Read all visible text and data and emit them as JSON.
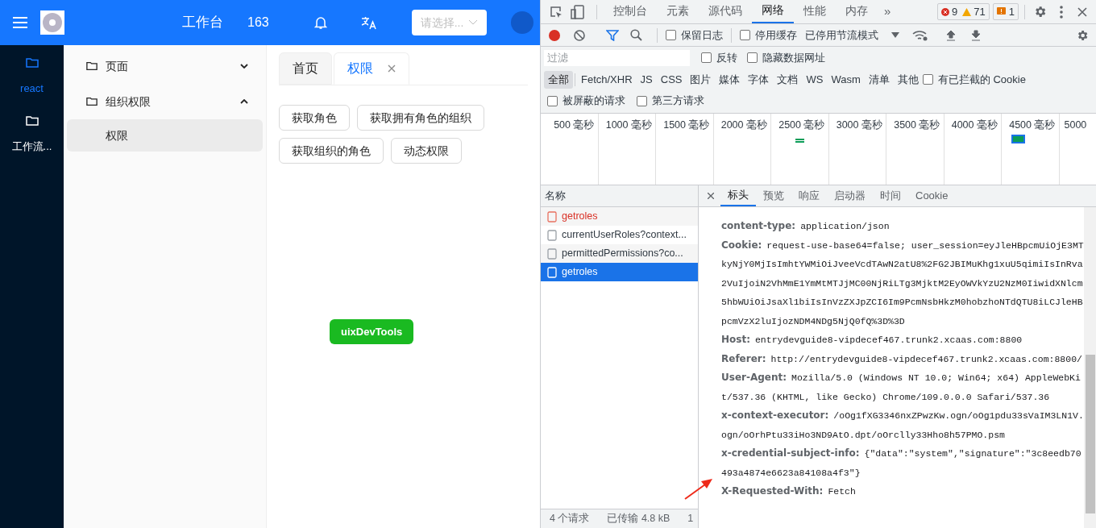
{
  "app": {
    "header": {
      "title": "工作台",
      "count": "163",
      "select_placeholder": "请选择..."
    },
    "rail": [
      {
        "label": "react",
        "selected": true
      },
      {
        "label": "工作流...",
        "selected": false
      }
    ],
    "menu": [
      {
        "label": "页面",
        "expanded": false
      },
      {
        "label": "组织权限",
        "expanded": true,
        "children": [
          {
            "label": "权限",
            "selected": true
          }
        ]
      }
    ],
    "tabs": [
      {
        "label": "首页",
        "selected": false,
        "closable": false
      },
      {
        "label": "权限",
        "selected": true,
        "closable": true
      }
    ],
    "buttons": [
      "获取角色",
      "获取拥有角色的组织",
      "获取组织的角色",
      "动态权限"
    ],
    "floating_button": "uixDevTools"
  },
  "devtools": {
    "tabs": [
      {
        "label": "控制台",
        "selected": false
      },
      {
        "label": "元素",
        "selected": false
      },
      {
        "label": "源代码",
        "selected": false
      },
      {
        "label": "网络",
        "selected": true
      },
      {
        "label": "性能",
        "selected": false
      },
      {
        "label": "内存",
        "selected": false
      }
    ],
    "more": "»",
    "errors": "9",
    "warnings": "71",
    "issues": "1",
    "toolbar": {
      "preserve_log": {
        "label": "保留日志",
        "checked": false
      },
      "disable_cache": {
        "label": "停用缓存",
        "checked": false
      },
      "throttling": "已停用节流模式"
    },
    "filter": {
      "placeholder": "过滤",
      "invert": {
        "label": "反转",
        "checked": false
      },
      "hide_data_urls": {
        "label": "隐藏数据网址",
        "checked": false
      }
    },
    "types": [
      {
        "label": "全部",
        "selected": true
      },
      {
        "label": "Fetch/XHR",
        "selected": false
      },
      {
        "label": "JS",
        "selected": false
      },
      {
        "label": "CSS",
        "selected": false
      },
      {
        "label": "图片",
        "selected": false
      },
      {
        "label": "媒体",
        "selected": false
      },
      {
        "label": "字体",
        "selected": false
      },
      {
        "label": "文档",
        "selected": false
      },
      {
        "label": "WS",
        "selected": false
      },
      {
        "label": "Wasm",
        "selected": false
      },
      {
        "label": "清单",
        "selected": false
      },
      {
        "label": "其他",
        "selected": false
      }
    ],
    "blocked_cookies": {
      "label": "有已拦截的 Cookie",
      "checked": false
    },
    "blocked_requests": {
      "label": "被屏蔽的请求",
      "checked": false
    },
    "third_party": {
      "label": "第三方请求",
      "checked": false
    },
    "timeline_ticks": [
      "500 毫秒",
      "1000 毫秒",
      "1500 毫秒",
      "2000 毫秒",
      "2500 毫秒",
      "3000 毫秒",
      "3500 毫秒",
      "4000 毫秒",
      "4500 毫秒",
      "5000"
    ],
    "name_column": "名称",
    "requests": [
      {
        "name": "getroles",
        "failed": true,
        "selected": false
      },
      {
        "name": "currentUserRoles?context...",
        "failed": false,
        "selected": false
      },
      {
        "name": "permittedPermissions?co...",
        "failed": false,
        "selected": false
      },
      {
        "name": "getroles",
        "failed": false,
        "selected": true
      }
    ],
    "detail_tabs": [
      {
        "label": "标头",
        "selected": true
      },
      {
        "label": "预览",
        "selected": false
      },
      {
        "label": "响应",
        "selected": false
      },
      {
        "label": "启动器",
        "selected": false
      },
      {
        "label": "时间",
        "selected": false
      },
      {
        "label": "Cookie",
        "selected": false
      }
    ],
    "headers": [
      {
        "name": "content-type:",
        "value": "application/json"
      },
      {
        "name": "Cookie:",
        "value": "request-use-base64=false; user_session=eyJleHBpcmUiOjE3MTkyNjY0MjIsImhtYWMiOiJveeVcdTAwN2atU8%2FG2JBIMuKhg1xuU5qimiIsInRva2VuIjoiN2VhMmE1YmMtMTJjMC00NjRiLTg3MjktM2EyOWVkYzU2NzM0IiwidXNlcm5hbWUiOiJsaXl1biIsInVzZXJpZCI6Im9PcmNsbHkzM0hobzhoNTdQTU8iLCJleHBpcmVzX2luIjozNDM4NDg5NjQ0fQ%3D%3D"
      },
      {
        "name": "Host:",
        "value": "entrydevguide8-vipdecef467.trunk2.xcaas.com:8800"
      },
      {
        "name": "Referer:",
        "value": "http://entrydevguide8-vipdecef467.trunk2.xcaas.com:8800/"
      },
      {
        "name": "User-Agent:",
        "value": "Mozilla/5.0 (Windows NT 10.0; Win64; x64) AppleWebKit/537.36 (KHTML, like Gecko) Chrome/109.0.0.0 Safari/537.36"
      },
      {
        "name": "x-context-executor:",
        "value": "/oOg1fXG3346nxZPwzKw.ogn/oOg1pdu33sVaIM3LN1V.ogn/oOrhPtu33iHo3ND9AtO.dpt/oOrclly33Hho8h57PMO.psm"
      },
      {
        "name": "x-credential-subject-info:",
        "value": "{\"data\":\"system\",\"signature\":\"3c8eedb70493a4874e6623a84108a4f3\"}"
      },
      {
        "name": "X-Requested-With:",
        "value": "Fetch"
      }
    ],
    "status": [
      "4 个请求",
      "已传输 4.8 kB",
      "1"
    ]
  }
}
